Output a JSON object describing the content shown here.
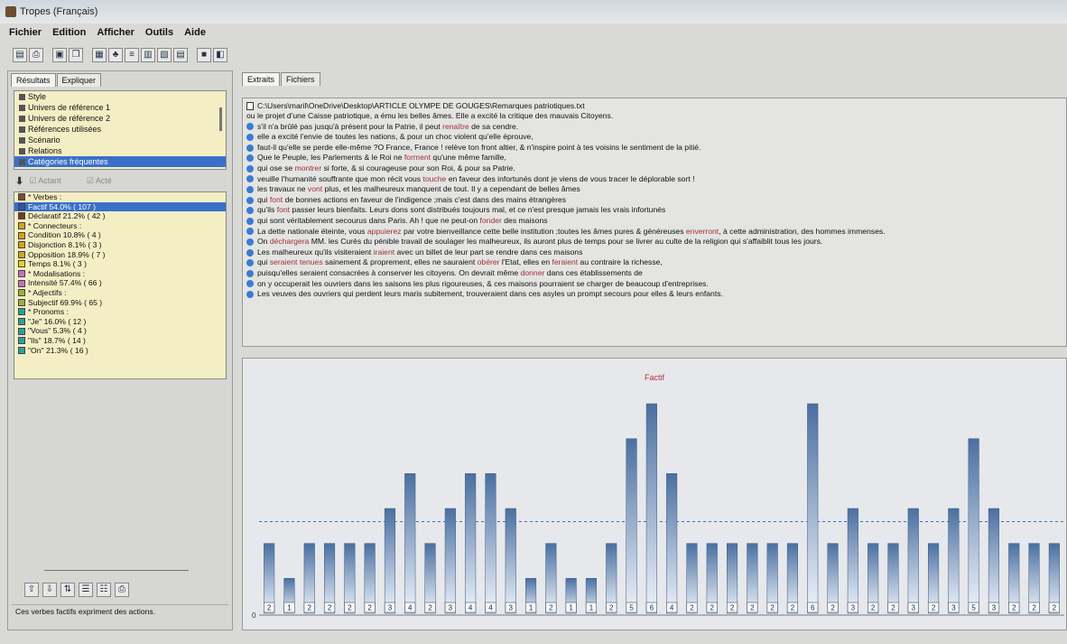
{
  "window": {
    "title": "Tropes (Français)"
  },
  "menu": [
    "Fichier",
    "Edition",
    "Afficher",
    "Outils",
    "Aide"
  ],
  "left_tabs": [
    "Résultats",
    "Expliquer"
  ],
  "categories": [
    "Style",
    "Univers de référence 1",
    "Univers de référence 2",
    "Références utilisées",
    "Scénario",
    "Relations",
    "Catégories fréquentes"
  ],
  "selected_category_index": 6,
  "actant": {
    "actant_label": "Actant",
    "acte_label": "Acté"
  },
  "verbs": [
    {
      "label": "* Verbes :",
      "color": "#7a4a3a"
    },
    {
      "label": "Factif  54.0% ( 107 )",
      "color": "#2e55a8",
      "selected": true
    },
    {
      "label": "Déclaratif  21.2% ( 42 )",
      "color": "#7a3a2a"
    },
    {
      "label": "* Connecteurs :",
      "color": "#d4a21c"
    },
    {
      "label": "Condition  10.8% ( 4 )",
      "color": "#d4a21c"
    },
    {
      "label": "Disjonction  8.1% ( 3 )",
      "color": "#d4a21c"
    },
    {
      "label": "Opposition  18.9% ( 7 )",
      "color": "#d4a21c"
    },
    {
      "label": "Temps  8.1% ( 3 )",
      "color": "#e5d21c"
    },
    {
      "label": "* Modalisations :",
      "color": "#c86cc8"
    },
    {
      "label": "Intensité  57.4% ( 66 )",
      "color": "#c86cc8"
    },
    {
      "label": "* Adjectifs :",
      "color": "#9ab03a"
    },
    {
      "label": "Subjectif  69.9% ( 65 )",
      "color": "#9ab03a"
    },
    {
      "label": "* Pronoms :",
      "color": "#2aa0a0"
    },
    {
      "label": "\"Je\"  16.0% ( 12 )",
      "color": "#2aa0a0"
    },
    {
      "label": "\"Vous\"  5.3% ( 4 )",
      "color": "#2aa0a0"
    },
    {
      "label": "\"Ils\"  18.7% ( 14 )",
      "color": "#2aa0a0"
    },
    {
      "label": "\"On\"  21.3% ( 16 )",
      "color": "#2aa0a0"
    }
  ],
  "left_status": "Ces verbes factifs expriment des actions.",
  "right_tabs": [
    "Extraits",
    "Fichiers"
  ],
  "file_path": "C:\\Users\\maril\\OneDrive\\Desktop\\ARTICLE OLYMPE DE GOUGES\\Remarques patriotiques.txt",
  "extracts": [
    {
      "bullet": false,
      "parts": [
        [
          "ou le projet d'une Caisse patriotique, a ému les belles âmes. Elle a excité la critique des mauvais Citoyens.",
          false
        ]
      ]
    },
    {
      "bullet": true,
      "parts": [
        [
          "s'il n'a brûlé pas jusqu'à présent pour la Patrie,  il peut ",
          false
        ],
        [
          "renaître",
          true
        ],
        [
          " de sa cendre.",
          false
        ]
      ]
    },
    {
      "bullet": true,
      "parts": [
        [
          "elle a excité l'envie de toutes les nations, & pour un choc violent  qu'elle éprouve,",
          false
        ]
      ]
    },
    {
      "bullet": true,
      "parts": [
        [
          " faut-il qu'elle se perde elle-même ?O France, France ! relève ton front altier, & n'inspire point à tes voisins le sentiment de la pitié.",
          false
        ]
      ]
    },
    {
      "bullet": true,
      "parts": [
        [
          "Que le Peuple, les Parlements & le Roi ne ",
          false
        ],
        [
          "forment",
          true
        ],
        [
          " qu'une même famille,",
          false
        ]
      ]
    },
    {
      "bullet": true,
      "parts": [
        [
          " qui ose se ",
          false
        ],
        [
          "montrer",
          true
        ],
        [
          " si forte, & si courageuse pour son Roi, & pour sa Patrie.",
          false
        ]
      ]
    },
    {
      "bullet": true,
      "parts": [
        [
          "veuille l'humanité souffrante que mon récit vous ",
          false
        ],
        [
          "touche",
          true
        ],
        [
          " en faveur des infortunés dont  je viens de vous tracer le déplorable sort !",
          false
        ]
      ]
    },
    {
      "bullet": true,
      "parts": [
        [
          " les travaux ne ",
          false
        ],
        [
          "vont",
          true
        ],
        [
          " plus,  et les malheureux manquent de tout.  Il y a cependant de belles âmes",
          false
        ]
      ]
    },
    {
      "bullet": true,
      "parts": [
        [
          " qui ",
          false
        ],
        [
          "font",
          true
        ],
        [
          " de bonnes actions en faveur de l'indigence ;mais c'est dans des mains étrangères",
          false
        ]
      ]
    },
    {
      "bullet": true,
      "parts": [
        [
          " qu'ils ",
          false
        ],
        [
          "font",
          true
        ],
        [
          " passer leurs bienfaits. Leurs dons sont distribués toujours mal,  et ce n'est presque jamais les vrais infortunés",
          false
        ]
      ]
    },
    {
      "bullet": true,
      "parts": [
        [
          " qui sont véritablement secourus dans Paris. Ah ! que ne peut-on ",
          false
        ],
        [
          "fonder",
          true
        ],
        [
          " des maisons",
          false
        ]
      ]
    },
    {
      "bullet": true,
      "parts": [
        [
          "La dette nationale éteinte,  vous ",
          false
        ],
        [
          "appuierez",
          true
        ],
        [
          " par votre bienveillance cette belle institution ;toutes les âmes pures & généreuses ",
          false
        ],
        [
          "enverront",
          true
        ],
        [
          ", à cette administration, des hommes immenses.",
          false
        ]
      ]
    },
    {
      "bullet": true,
      "parts": [
        [
          "On ",
          false
        ],
        [
          "déchargera",
          true
        ],
        [
          " MM. les Curés du pénible travail de soulager les malheureux,  ils auront plus de temps pour se livrer au culte de la religion qui s'affaiblit tous les jours.",
          false
        ]
      ]
    },
    {
      "bullet": true,
      "parts": [
        [
          "Les malheureux qu'ils visiteraient ",
          false
        ],
        [
          "iraient",
          true
        ],
        [
          " avec un billet de leur part se rendre dans ces maisons",
          false
        ]
      ]
    },
    {
      "bullet": true,
      "parts": [
        [
          " qui ",
          false
        ],
        [
          "seraient tenues",
          true
        ],
        [
          " sainement & proprement,  elles ne sauraient ",
          false
        ],
        [
          "obérer",
          true
        ],
        [
          " l'Etat,  elles en ",
          false
        ],
        [
          "feraient",
          true
        ],
        [
          " au contraire la richesse,",
          false
        ]
      ]
    },
    {
      "bullet": true,
      "parts": [
        [
          " puisqu'elles seraient consacrées à conserver les citoyens. On devrait même ",
          false
        ],
        [
          "donner",
          true
        ],
        [
          " dans ces établissements de",
          false
        ]
      ]
    },
    {
      "bullet": true,
      "parts": [
        [
          " on y occuperait les ouvriers dans les saisons les plus rigoureuses,  & ces maisons pourraient se charger de beaucoup d'entreprises.",
          false
        ]
      ]
    },
    {
      "bullet": true,
      "parts": [
        [
          "Les veuves des ouvriers qui perdent leurs maris subitement,  trouveraient dans ces asyles un prompt secours pour elles & leurs enfants.",
          false
        ]
      ]
    }
  ],
  "chart_data": {
    "type": "bar",
    "title": "Factif",
    "values": [
      2,
      1,
      2,
      2,
      2,
      2,
      3,
      4,
      2,
      3,
      4,
      4,
      3,
      1,
      2,
      1,
      1,
      2,
      5,
      6,
      4,
      2,
      2,
      2,
      2,
      2,
      2,
      6,
      2,
      3,
      2,
      2,
      3,
      2,
      3,
      5,
      3,
      2,
      2,
      2
    ],
    "value_labels": [
      "2",
      "1",
      "2",
      "2",
      "2",
      "2",
      "3",
      "4",
      "2",
      "3",
      "4",
      "4",
      "3",
      "1",
      "2",
      "1",
      "1",
      "2",
      "5",
      "6",
      "4",
      "2",
      "2",
      "2",
      "2",
      "2",
      "2",
      "6",
      "2",
      "3",
      "2",
      "2",
      "3",
      "2",
      "3",
      "5",
      "3",
      "2",
      "2",
      "2"
    ],
    "mean_line": true,
    "y_axis_label": "0",
    "bar_color_top": "#4a6fa0",
    "bar_color_bottom": "#eef3fa"
  }
}
